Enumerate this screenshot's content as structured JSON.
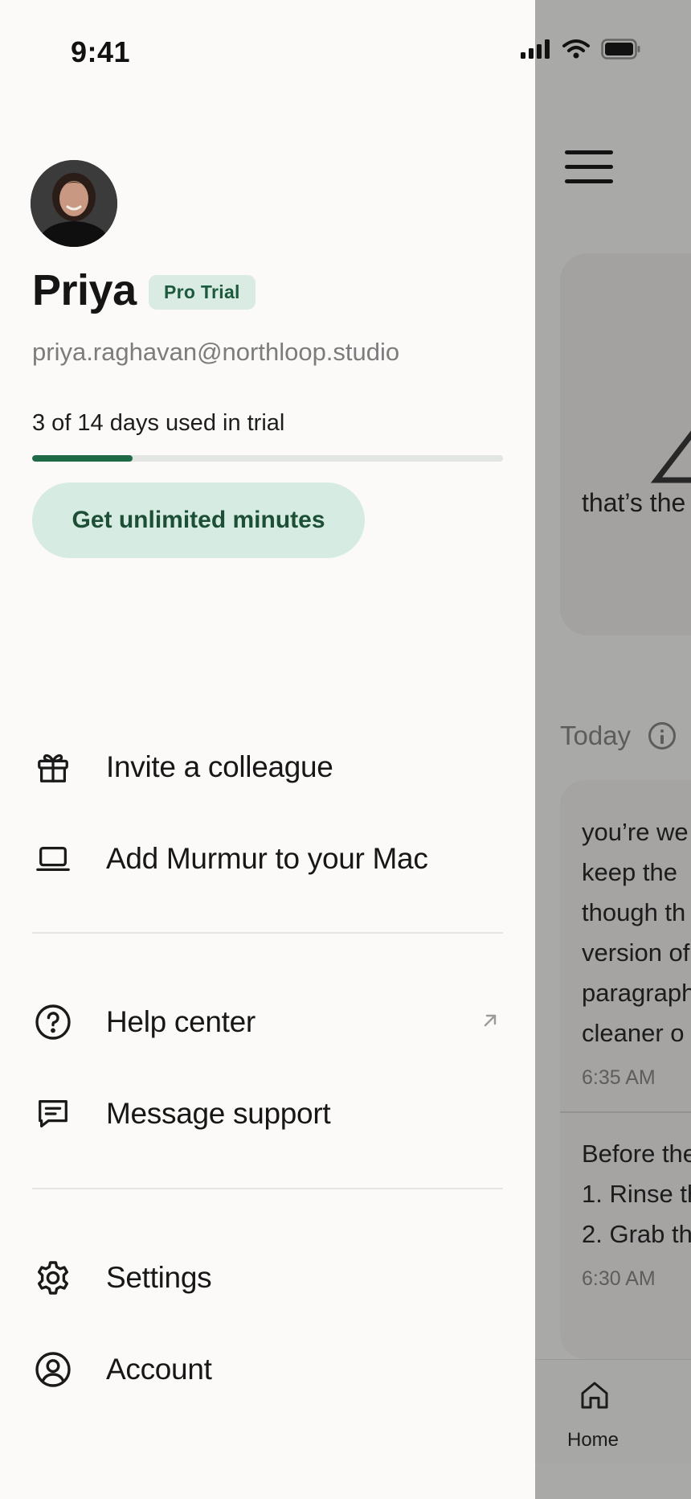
{
  "status_bar": {
    "time": "9:41"
  },
  "profile": {
    "name": "Priya",
    "plan_badge": "Pro Trial",
    "email": "priya.raghavan@northloop.studio",
    "trial_text": "3 of 14 days used in trial",
    "trial_progress_fraction": 0.214,
    "upgrade_label": "Get unlimited minutes"
  },
  "menu": {
    "invite_label": "Invite a colleague",
    "add_mac_label": "Add Murmur to your Mac",
    "help_label": "Help center",
    "support_label": "Message support",
    "settings_label": "Settings",
    "account_label": "Account"
  },
  "background": {
    "hero_text": "that’s the",
    "today_label": "Today",
    "notes": [
      {
        "lines": [
          "you’re we",
          "keep the",
          "though th",
          "version of",
          "paragraph",
          "cleaner o"
        ],
        "time": "6:35 AM"
      },
      {
        "lines": [
          "Before the",
          "1. Rinse th",
          "2. Grab th"
        ],
        "time": "6:30 AM"
      }
    ],
    "tab_home_label": "Home"
  },
  "colors": {
    "accent": "#1f6b48",
    "accent_soft": "#d6ebe1",
    "drawer_bg": "#fbfaf8"
  },
  "icons": {
    "invite": "gift-icon",
    "add_mac": "laptop-icon",
    "help": "help-circle-icon",
    "help_external": "external-arrow-icon",
    "support": "message-icon",
    "settings": "gear-icon",
    "account": "user-circle-icon"
  }
}
